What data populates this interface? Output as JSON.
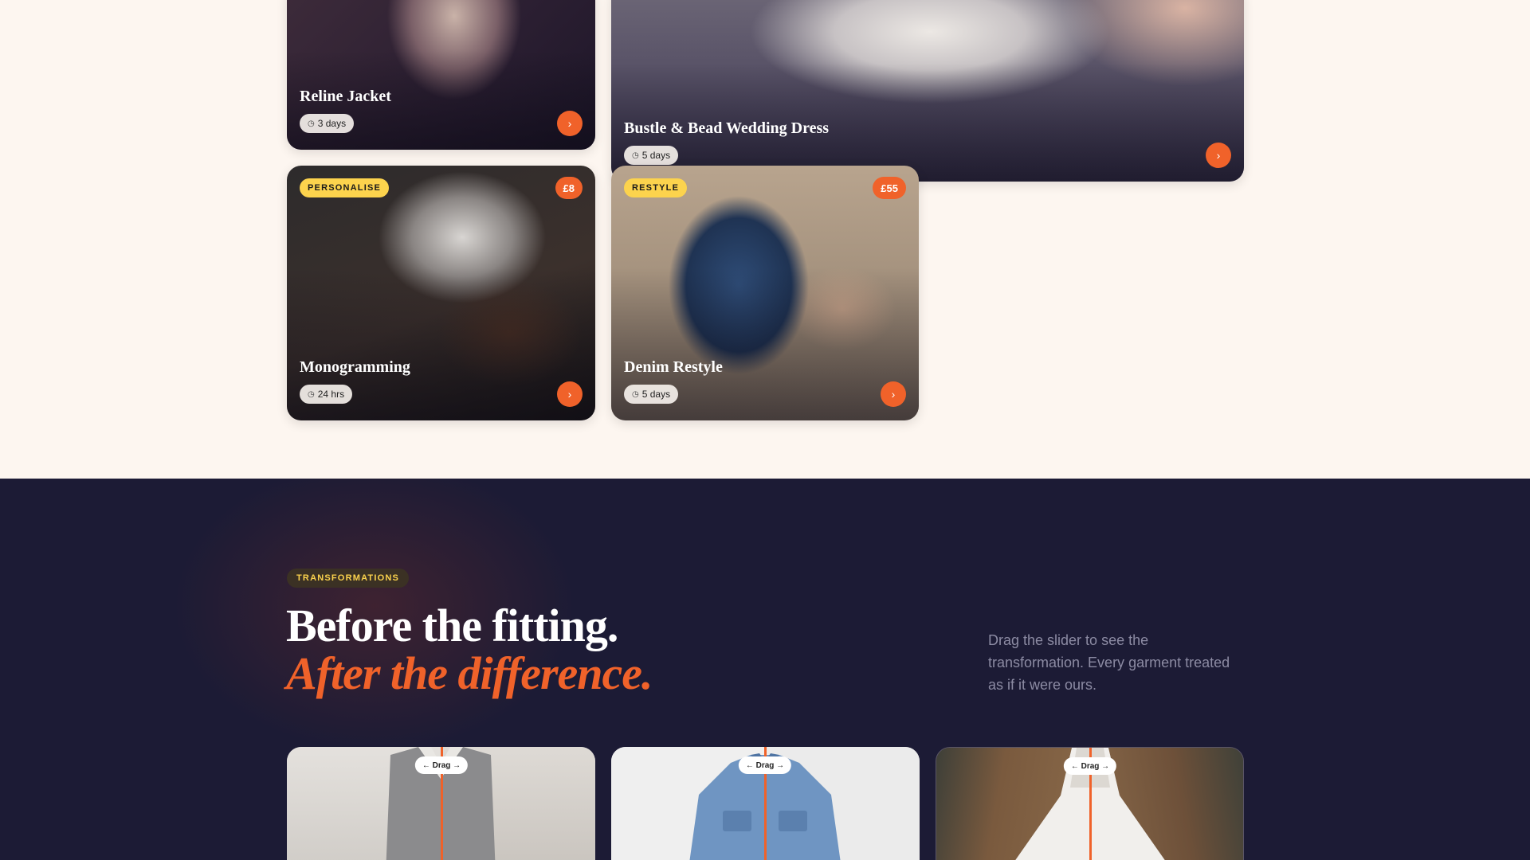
{
  "services": [
    {
      "title": "Reline Jacket",
      "duration": "3 days",
      "tag": "",
      "price": ""
    },
    {
      "title": "Bustle & Bead Wedding Dress",
      "duration": "5 days",
      "tag": "",
      "price": ""
    },
    {
      "title": "Monogramming",
      "duration": "24 hrs",
      "tag": "PERSONALISE",
      "price": "£8"
    },
    {
      "title": "Denim Restyle",
      "duration": "5 days",
      "tag": "RESTYLE",
      "price": "£55"
    }
  ],
  "icons": {
    "duration": "clock-icon",
    "go": "chevron-right-icon"
  },
  "transformations": {
    "kicker": "TRANSFORMATIONS",
    "title_line1": "Before the fitting.",
    "title_line2": "After the difference.",
    "description": "Drag the slider to see the transformation. Every garment treated as if it were ours.",
    "slider_label": "← Drag →",
    "slider_position_percent": 50
  },
  "colors": {
    "accent": "#f0622a",
    "tag": "#fcd34d",
    "dark_bg": "#1c1b35",
    "light_bg": "#fdf6f0"
  }
}
